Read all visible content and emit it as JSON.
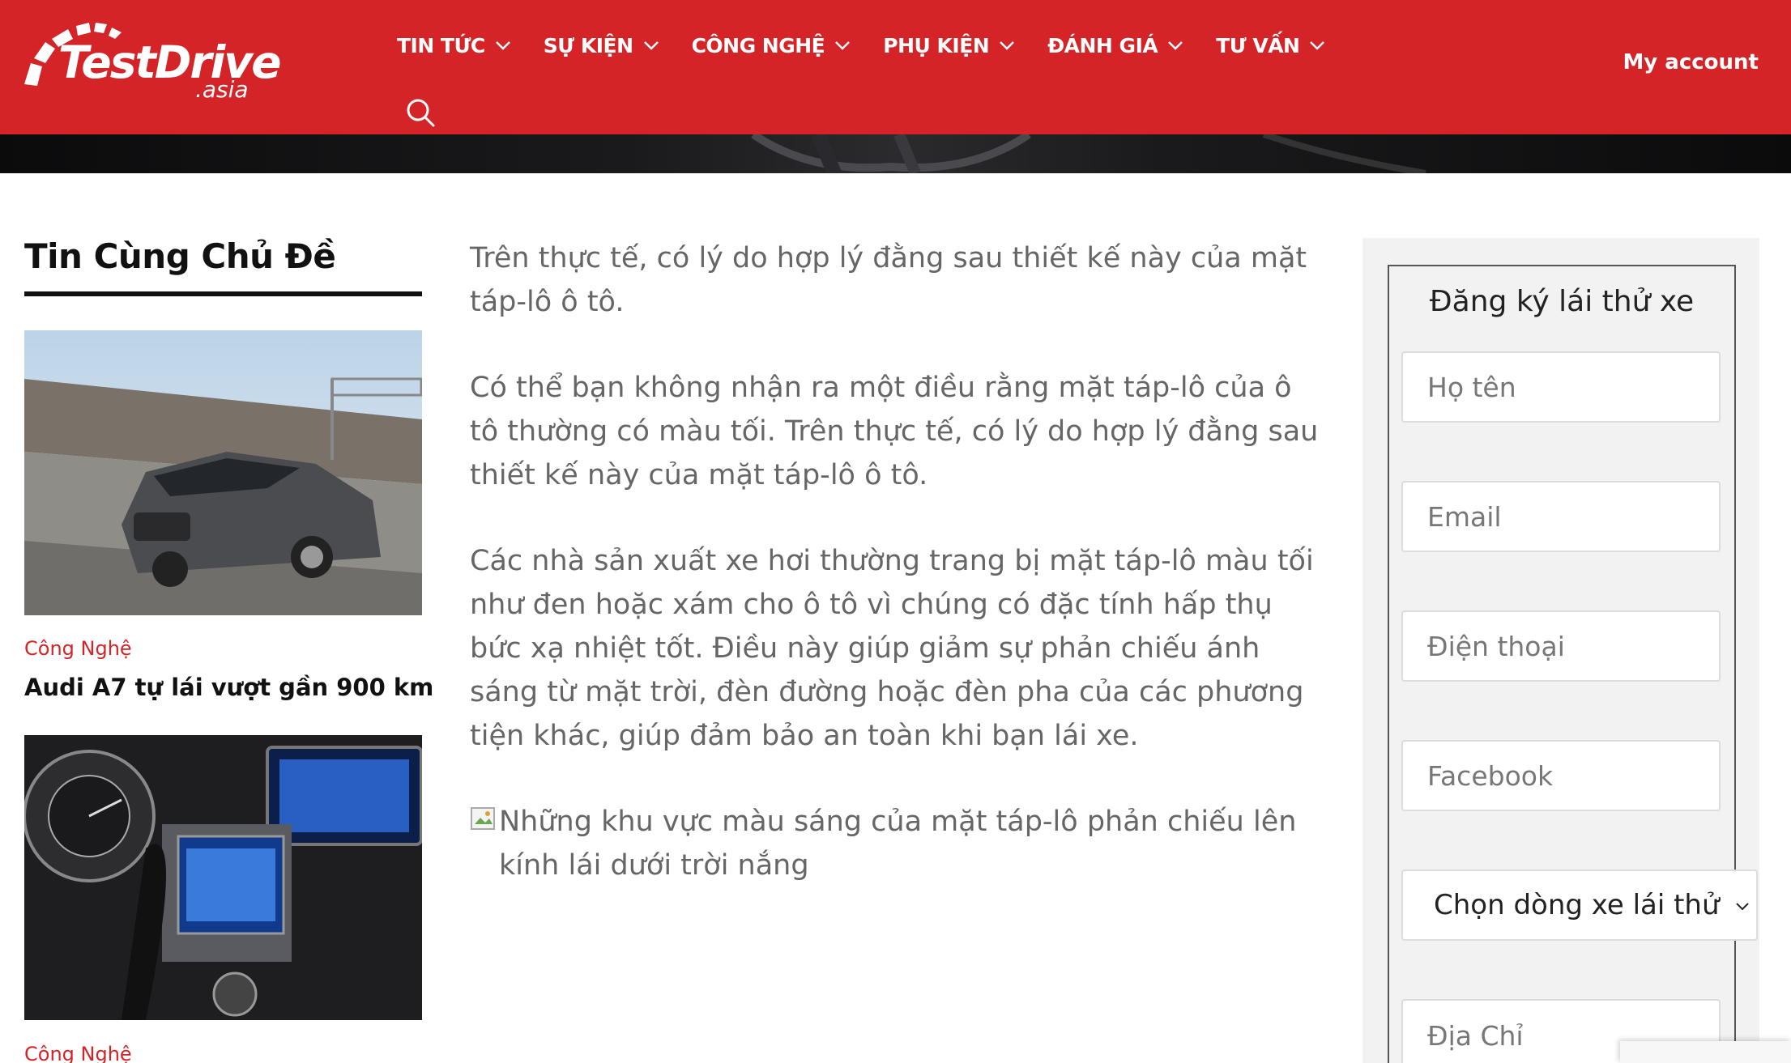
{
  "brand": {
    "logo_main": "TestDrive",
    "logo_sub": ".asia",
    "brand_color": "#d42428"
  },
  "nav": {
    "items": [
      {
        "label": "TIN TỨC",
        "icon": "chevron-down-icon"
      },
      {
        "label": "SỰ KIỆN",
        "icon": "chevron-down-icon"
      },
      {
        "label": "CÔNG NGHỆ",
        "icon": "chevron-down-icon"
      },
      {
        "label": "PHỤ KIỆN",
        "icon": "chevron-down-icon"
      },
      {
        "label": "ĐÁNH GIÁ",
        "icon": "chevron-down-icon"
      },
      {
        "label": "TƯ VẤN",
        "icon": "chevron-down-icon"
      }
    ],
    "search_icon": "search-icon",
    "account_label": "My account"
  },
  "sidebar": {
    "title": "Tin Cùng Chủ Đề",
    "cards": [
      {
        "category": "Công Nghệ",
        "title": "Audi A7 tự lái vượt gần 900 km",
        "image": "gray-audi-sedan-on-highway"
      },
      {
        "category": "Công Nghệ",
        "title": "",
        "image": "car-dashboard-infotainment"
      }
    ]
  },
  "article": {
    "paragraphs": [
      "Trên thực tế, có lý do hợp lý đằng sau thiết kế này của mặt táp-lô ô tô.",
      "Có thể bạn không nhận ra một điều rằng mặt táp-lô của ô tô thường có màu tối. Trên thực tế, có lý do hợp lý đằng sau thiết kế này của mặt táp-lô ô tô.",
      "Các nhà sản xuất xe hơi thường trang bị mặt táp-lô màu tối như đen hoặc xám cho ô tô vì chúng có đặc tính hấp thụ bức xạ nhiệt tốt. Điều này giúp giảm sự phản chiếu ánh sáng từ mặt trời, đèn đường hoặc đèn pha của các phương tiện khác, giúp đảm bảo an toàn khi bạn lái xe."
    ],
    "image_alt": "Những khu vực màu sáng của mặt táp-lô phản chiếu lên kính lái dưới trời nắng"
  },
  "form": {
    "title": "Đăng ký lái thử xe",
    "fields": [
      {
        "placeholder": "Họ tên",
        "value": ""
      },
      {
        "placeholder": "Email",
        "value": ""
      },
      {
        "placeholder": "Điện thoại",
        "value": ""
      },
      {
        "placeholder": "Facebook",
        "value": ""
      }
    ],
    "select_value": "Chọn dòng xe lái thử",
    "address_placeholder": "Địa Chỉ"
  }
}
